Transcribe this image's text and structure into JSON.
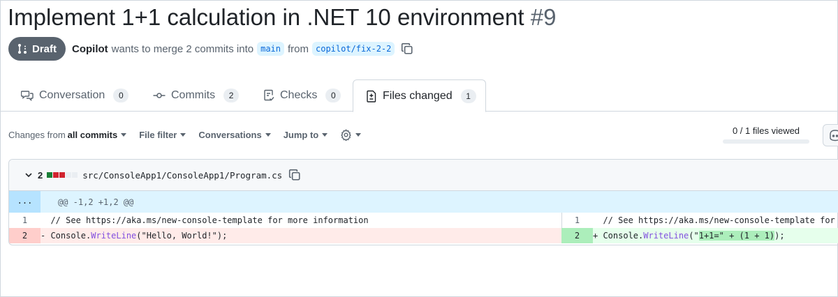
{
  "pr": {
    "title": "Implement 1+1 calculation in .NET 10 environment",
    "number": "#9",
    "status": "Draft",
    "author": "Copilot",
    "merge_text": "wants to merge 2 commits into",
    "base_branch": "main",
    "from_text": "from",
    "head_branch": "copilot/fix-2-2"
  },
  "tabs": [
    {
      "label": "Conversation",
      "count": "0",
      "icon": "comment-discussion-icon"
    },
    {
      "label": "Commits",
      "count": "2",
      "icon": "git-commit-icon"
    },
    {
      "label": "Checks",
      "count": "0",
      "icon": "checklist-icon"
    },
    {
      "label": "Files changed",
      "count": "1",
      "icon": "file-diff-icon",
      "active": true
    }
  ],
  "toolbar": {
    "changes_prefix": "Changes from",
    "changes_value": "all commits",
    "file_filter": "File filter",
    "conversations": "Conversations",
    "jump_to": "Jump to",
    "files_viewed": "0 / 1 files viewed"
  },
  "file": {
    "changes_count": "2",
    "path": "src/ConsoleApp1/ConsoleApp1/Program.cs",
    "hunk_expand": "...",
    "hunk_header": "@@ -1,2 +1,2 @@",
    "lines": {
      "left_1_num": "1",
      "left_1_code": "  // See https://aka.ms/new-console-template for more information",
      "left_2_num": "2",
      "left_2_sign": "- ",
      "left_2_obj": "Console.",
      "left_2_method": "WriteLine",
      "left_2_args": "(\"Hello, World!\");",
      "right_1_num": "1",
      "right_1_code": "  // See https://aka.ms/new-console-template for more information",
      "right_2_num": "2",
      "right_2_sign": "+ ",
      "right_2_obj": "Console.",
      "right_2_method": "WriteLine",
      "right_2_open": "(\"",
      "right_2_highlight": "1+1=\" + (1 + 1)",
      "right_2_close": ");"
    }
  },
  "colors": {
    "draft_badge": "#59636e",
    "branch_bg": "#ddf4ff",
    "branch_text": "#0969da",
    "deletion_bg": "#ffebe9",
    "addition_bg": "#e6ffec",
    "diffstat": [
      "#1a7f37",
      "#d1242f",
      "#d1242f",
      "#eaeef2",
      "#eaeef2"
    ]
  }
}
